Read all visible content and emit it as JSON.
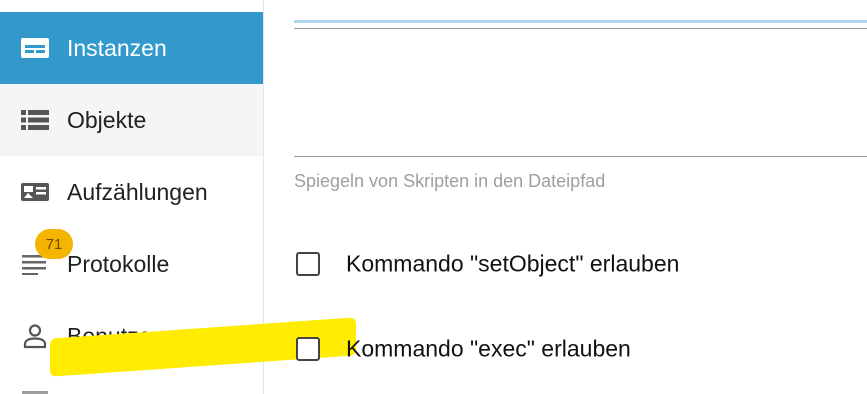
{
  "sidebar": {
    "items": [
      {
        "label": "Instanzen",
        "icon": "instances-icon",
        "state": "active"
      },
      {
        "label": "Objekte",
        "icon": "list-icon",
        "state": "hover"
      },
      {
        "label": "Aufzählungen",
        "icon": "enum-card-icon",
        "state": "normal"
      },
      {
        "label": "Protokolle",
        "icon": "log-lines-icon",
        "state": "normal",
        "badge": "71"
      },
      {
        "label": "Benutzer",
        "icon": "person-icon",
        "state": "normal"
      }
    ],
    "active_color": "#3399cc",
    "badge_color": "#f5b400"
  },
  "settings": {
    "mirror_path_helper": "Spiegeln von Skripten in den Dateipfad",
    "checkboxes": [
      {
        "label": "Kommando \"setObject\" erlauben",
        "checked": false
      },
      {
        "label": "Kommando \"exec\" erlauben",
        "checked": false,
        "highlighted": true
      }
    ],
    "highlight_color": "#ffec00"
  }
}
